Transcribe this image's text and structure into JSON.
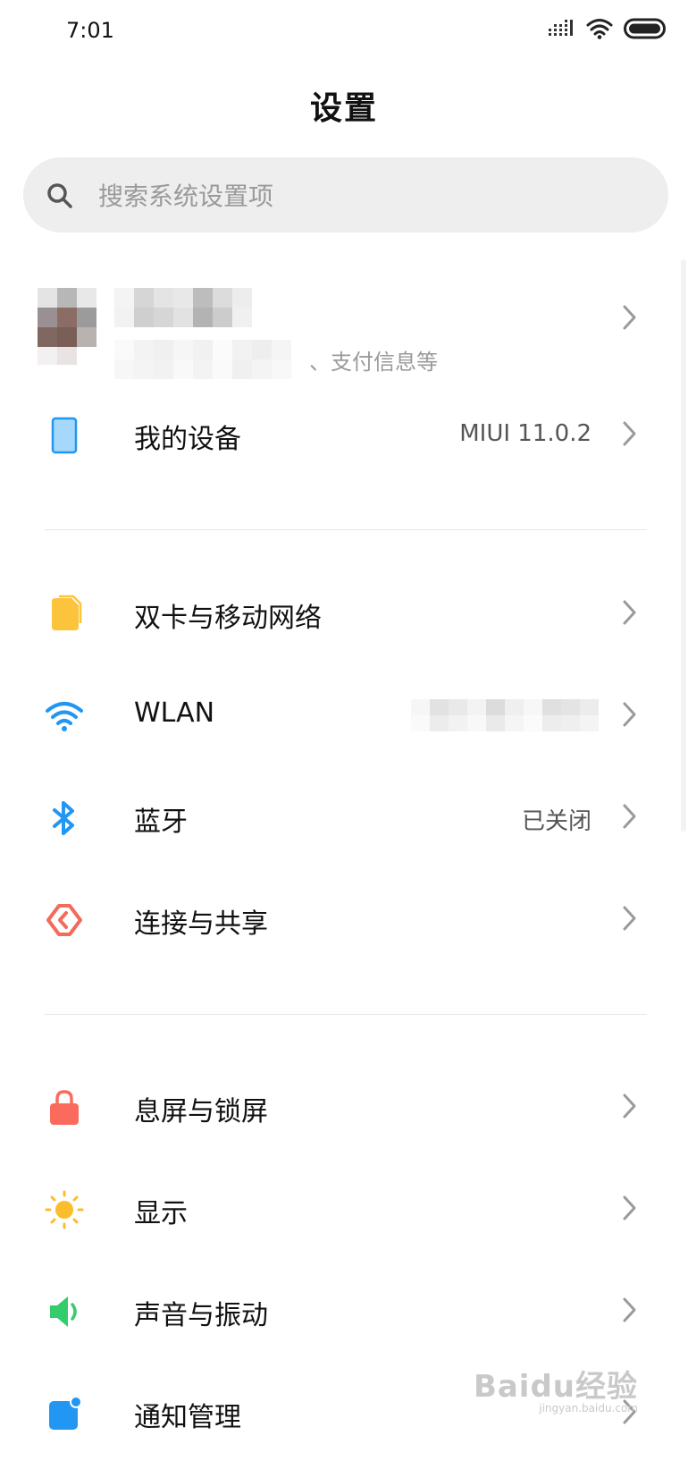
{
  "status_bar": {
    "time": "7:01",
    "icons": [
      "signal-icon",
      "wifi-icon",
      "battery-icon"
    ]
  },
  "page": {
    "title": "设置"
  },
  "search": {
    "placeholder": "搜索系统设置项"
  },
  "account": {
    "subtitle_visible": "、支付信息等"
  },
  "sections": [
    {
      "items": [
        {
          "label": "我的设备",
          "value": "MIUI 11.0.2",
          "icon": "device-icon"
        }
      ]
    },
    {
      "items": [
        {
          "label": "双卡与移动网络",
          "value": "",
          "icon": "sim-card-icon"
        },
        {
          "label": "WLAN",
          "value": "",
          "icon": "wifi-icon"
        },
        {
          "label": "蓝牙",
          "value": "已关闭",
          "icon": "bluetooth-icon"
        },
        {
          "label": "连接与共享",
          "value": "",
          "icon": "share-icon"
        }
      ]
    },
    {
      "items": [
        {
          "label": "息屏与锁屏",
          "value": "",
          "icon": "lock-icon"
        },
        {
          "label": "显示",
          "value": "",
          "icon": "sun-icon"
        },
        {
          "label": "声音与振动",
          "value": "",
          "icon": "speaker-icon"
        },
        {
          "label": "通知管理",
          "value": "",
          "icon": "notification-icon"
        }
      ]
    }
  ],
  "watermark": {
    "logo": "Baidu经验",
    "sub": "jingyan.baidu.com"
  },
  "colors": {
    "accent_blue": "#2196f3",
    "device_blue": "#a6d8fb",
    "sim_yellow": "#fcc33c",
    "share_red": "#f26b5b",
    "lock_red": "#fb6b5d",
    "sun_yellow": "#fbbd2c",
    "speaker_green": "#35cc6c",
    "search_bg": "#eeeeee",
    "chevron_gray": "#9a9a9a"
  }
}
